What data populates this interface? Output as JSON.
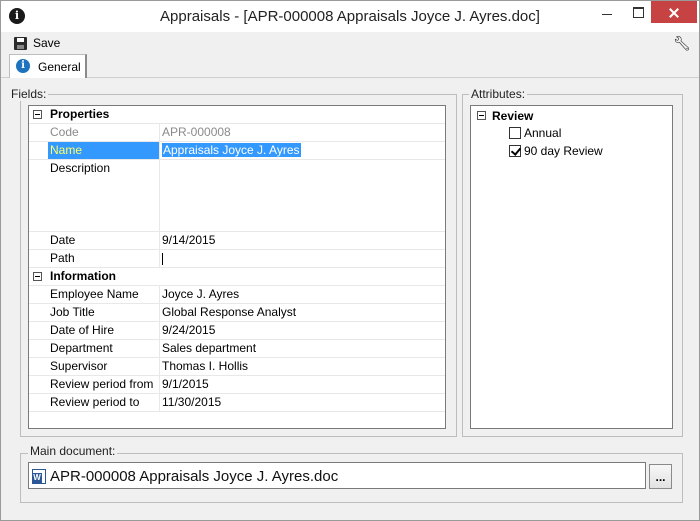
{
  "window": {
    "title": "Appraisals - [APR-000008 Appraisals Joyce J. Ayres.doc]",
    "icon": "info-icon"
  },
  "toolbar": {
    "save_label": "Save",
    "save_icon": "floppy-disk-icon",
    "settings_icon": "wrench-icon"
  },
  "tabs": [
    {
      "label": "General",
      "icon": "info-icon",
      "active": true
    }
  ],
  "fields": {
    "group_label": "Fields:",
    "categories": {
      "properties": "Properties",
      "information": "Information"
    },
    "rows": {
      "code": {
        "label": "Code",
        "value": "APR-000008"
      },
      "name": {
        "label": "Name",
        "value": "Appraisals Joyce J. Ayres"
      },
      "description": {
        "label": "Description",
        "value": ""
      },
      "date": {
        "label": "Date",
        "value": "9/14/2015"
      },
      "path": {
        "label": "Path",
        "value": ""
      },
      "employee": {
        "label": "Employee Name",
        "value": "Joyce J. Ayres"
      },
      "job_title": {
        "label": "Job Title",
        "value": "Global Response Analyst"
      },
      "hire_date": {
        "label": "Date of Hire",
        "value": "9/24/2015"
      },
      "department": {
        "label": "Department",
        "value": "Sales department"
      },
      "supervisor": {
        "label": "Supervisor",
        "value": "Thomas I. Hollis"
      },
      "period_from": {
        "label": "Review period from",
        "value": "9/1/2015"
      },
      "period_to": {
        "label": "Review period to",
        "value": "11/30/2015"
      }
    }
  },
  "attributes": {
    "group_label": "Attributes:",
    "root": "Review",
    "items": [
      {
        "label": "Annual",
        "checked": false
      },
      {
        "label": "90 day Review",
        "checked": true
      }
    ]
  },
  "main_document": {
    "group_label": "Main document:",
    "file_name": "APR-000008 Appraisals Joyce J. Ayres.doc",
    "browse_label": "...",
    "file_icon": "word-document-icon"
  },
  "colors": {
    "selection": "#3399ff",
    "selection_label_text": "#ffff66",
    "close_button": "#c74242"
  }
}
